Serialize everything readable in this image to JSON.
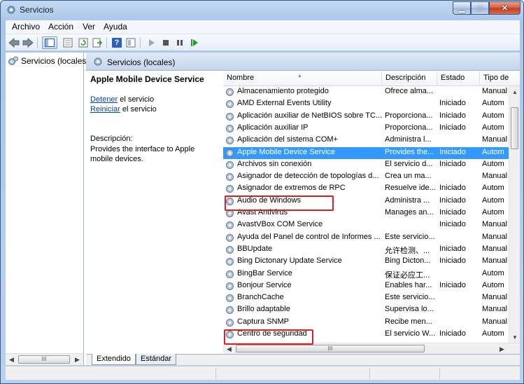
{
  "window": {
    "title": "Servicios"
  },
  "window_controls": {
    "minimize": "▁",
    "maximize": "□",
    "close": "✕"
  },
  "menu": [
    "Archivo",
    "Acción",
    "Ver",
    "Ayuda"
  ],
  "toolbar": {
    "icons": [
      "back-icon",
      "forward-icon",
      "show-console-tree-icon",
      "properties-icon",
      "refresh-icon",
      "export-list-icon",
      "help-icon",
      "view-icon",
      "start-service-icon",
      "stop-service-icon",
      "pause-service-icon",
      "resume-service-icon"
    ],
    "help_glyph": "?"
  },
  "tree": {
    "root": "Servicios (locales)",
    "scroll_thumb": "III"
  },
  "main": {
    "header": "Servicios (locales)"
  },
  "details": {
    "service_name": "Apple Mobile Device Service",
    "stop_link": "Detener",
    "stop_suffix": " el servicio",
    "restart_link": "Reiniciar",
    "restart_suffix": " el servicio",
    "description_label": "Descripción:",
    "description": "Provides the interface to Apple mobile devices."
  },
  "grid": {
    "columns": [
      "Nombre",
      "Descripción",
      "Estado",
      "Tipo de"
    ],
    "sort_glyph": "▲",
    "scroll_thumb": "III",
    "rows": [
      {
        "name": "Almacenamiento protegido",
        "desc": "Ofrece alma...",
        "state": "",
        "type": "Manual"
      },
      {
        "name": "AMD External Events Utility",
        "desc": "",
        "state": "Iniciado",
        "type": "Autom"
      },
      {
        "name": "Aplicación auxiliar de NetBIOS sobre TC...",
        "desc": "Proporciona...",
        "state": "Iniciado",
        "type": "Autom"
      },
      {
        "name": "Aplicación auxiliar IP",
        "desc": "Proporciona...",
        "state": "Iniciado",
        "type": "Autom"
      },
      {
        "name": "Aplicación del sistema COM+",
        "desc": "Administra l...",
        "state": "",
        "type": "Manual"
      },
      {
        "name": "Apple Mobile Device Service",
        "desc": "Provides the...",
        "state": "Iniciado",
        "type": "Autom"
      },
      {
        "name": "Archivos sin conexión",
        "desc": "El servicio d...",
        "state": "Iniciado",
        "type": "Autom"
      },
      {
        "name": "Asignador de detección de topologías d...",
        "desc": "Crea un ma...",
        "state": "",
        "type": "Manual"
      },
      {
        "name": "Asignador de extremos de RPC",
        "desc": "Resuelve ide...",
        "state": "Iniciado",
        "type": "Autom"
      },
      {
        "name": "Audio de Windows",
        "desc": "Administra ...",
        "state": "Iniciado",
        "type": "Autom"
      },
      {
        "name": "Avast Antivirus",
        "desc": "Manages an...",
        "state": "Iniciado",
        "type": "Autom"
      },
      {
        "name": "AvastVBox COM Service",
        "desc": "",
        "state": "Iniciado",
        "type": "Manual"
      },
      {
        "name": "Ayuda del Panel de control de Informes ...",
        "desc": "Este servicio...",
        "state": "",
        "type": "Manual"
      },
      {
        "name": "BBUpdate",
        "desc": "允许检测、...",
        "state": "Iniciado",
        "type": "Manual"
      },
      {
        "name": "Bing Dictonary Update Service",
        "desc": "Bing Dicton...",
        "state": "Iniciado",
        "type": "Manual"
      },
      {
        "name": "BingBar Service",
        "desc": "保证必应工...",
        "state": "",
        "type": "Autom"
      },
      {
        "name": "Bonjour Service",
        "desc": "Enables har...",
        "state": "Iniciado",
        "type": "Autom"
      },
      {
        "name": "BranchCache",
        "desc": "Este servicio...",
        "state": "",
        "type": "Manual"
      },
      {
        "name": "Brillo adaptable",
        "desc": "Supervisa lo...",
        "state": "",
        "type": "Manual"
      },
      {
        "name": "Captura SNMP",
        "desc": "Recibe men...",
        "state": "",
        "type": "Manual"
      },
      {
        "name": "Centro de seguridad",
        "desc": "El servicio W...",
        "state": "Iniciado",
        "type": "Autom"
      }
    ]
  },
  "tabs": [
    "Extendido",
    "Estándar"
  ],
  "colors": {
    "selection": "#3399ff",
    "highlight": "#e02020",
    "link": "#0645ad"
  }
}
